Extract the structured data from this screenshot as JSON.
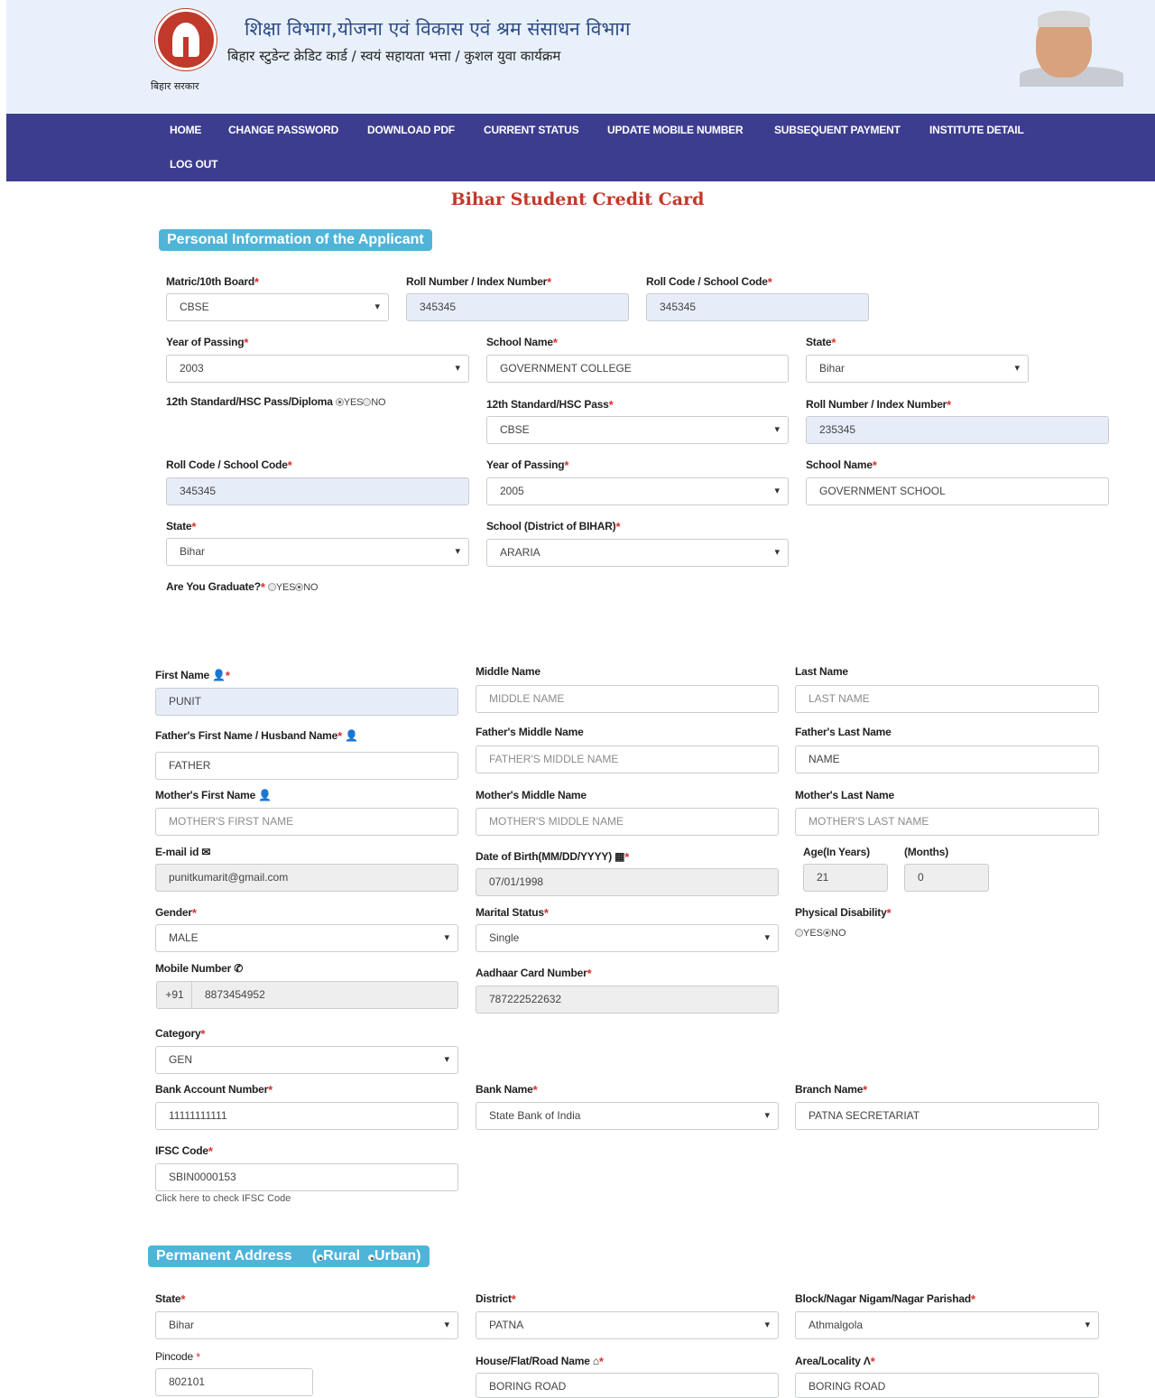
{
  "header": {
    "title": "शिक्षा विभाग,योजना एवं विकास एवं श्रम संसाधन विभाग",
    "subtitle": "बिहार स्टुडेन्ट क्रेडिट कार्ड / स्वयं सहायता भत्ता / कुशल युवा कार्यक्रम",
    "emblem_text": "बिहार सरकार"
  },
  "nav": [
    "HOME",
    "CHANGE PASSWORD",
    "DOWNLOAD PDF",
    "CURRENT STATUS",
    "UPDATE MOBILE NUMBER",
    "SUBSEQUENT PAYMENT",
    "INSTITUTE DETAIL",
    "LOG OUT"
  ],
  "page_title": "Bihar Student Credit Card",
  "personal": {
    "heading": "Personal Information of the Applicant",
    "labels": {
      "matric_board": "Matric/10th Board",
      "roll_number": "Roll Number / Index Number",
      "roll_code": "Roll Code / School Code",
      "year_of_passing": "Year of Passing",
      "school_name": "School Name",
      "state": "State",
      "hsc_question": "12th Standard/HSC Pass/Diploma",
      "hsc_pass": "12th Standard/HSC Pass",
      "hsc_roll_number": "Roll Number / Index Number",
      "hsc_roll_code": "Roll Code / School Code",
      "hsc_year": "Year of Passing",
      "hsc_school_name": "School Name",
      "hsc_state": "State",
      "school_district": "School (District of BIHAR)",
      "graduate_question": "Are You Graduate?"
    },
    "values": {
      "matric_board": "CBSE",
      "roll_number": "345345",
      "roll_code": "345345",
      "year_of_passing": "2003",
      "school_name": "GOVERNMENT COLLEGE",
      "state": "Bihar",
      "hsc_pass": "CBSE",
      "hsc_roll_number": "235345",
      "hsc_roll_code": "345345",
      "hsc_year": "2005",
      "hsc_school_name": "GOVERNMENT SCHOOL",
      "hsc_state": "Bihar",
      "school_district": "ARARIA"
    },
    "radio": {
      "yes": "YES",
      "no": "NO"
    }
  },
  "applicant": {
    "labels": {
      "first_name": "First Name",
      "middle_name": "Middle Name",
      "last_name": "Last Name",
      "father_first": "Father's First Name / Husband Name",
      "father_middle": "Father's Middle Name",
      "father_last": "Father's Last Name",
      "mother_first": "Mother's First Name",
      "mother_middle": "Mother's Middle Name",
      "mother_last": "Mother's Last Name",
      "email": "E-mail id",
      "dob": "Date of Birth(MM/DD/YYYY)",
      "age_years": "Age(In Years)",
      "age_months": "(Months)",
      "gender": "Gender",
      "marital_status": "Marital Status",
      "physical_disability": "Physical Disability",
      "mobile": "Mobile Number",
      "aadhaar": "Aadhaar Card Number",
      "category": "Category",
      "bank_account": "Bank Account Number",
      "bank_name": "Bank Name",
      "branch_name": "Branch Name",
      "ifsc": "IFSC Code"
    },
    "values": {
      "first_name": "PUNIT",
      "father_first": "FATHER",
      "father_last": "NAME",
      "email": "punitkumarit@gmail.com",
      "dob": "07/01/1998",
      "age_years": "21",
      "age_months": "0",
      "gender": "MALE",
      "marital_status": "Single",
      "mobile_prefix": "+91",
      "mobile": "8873454952",
      "aadhaar": "787222522632",
      "category": "GEN",
      "bank_account": "11111111111",
      "bank_name": "State Bank of India",
      "branch_name": "PATNA SECRETARIAT",
      "ifsc": "SBIN0000153"
    },
    "placeholders": {
      "middle_name": "MIDDLE NAME",
      "last_name": "LAST NAME",
      "father_middle": "FATHER'S MIDDLE NAME",
      "mother_first": "MOTHER'S FIRST NAME",
      "mother_middle": "MOTHER'S MIDDLE NAME",
      "mother_last": "MOTHER'S LAST NAME"
    },
    "ifsc_helper": "Click here to check IFSC Code"
  },
  "address": {
    "heading": "Permanent Address",
    "rural": "Rural",
    "urban": "Urban",
    "labels": {
      "state": "State",
      "district": "District",
      "block": "Block/Nagar Nigam/Nagar Parishad",
      "pincode": "Pincode",
      "house": "House/Flat/Road Name",
      "area": "Area/Locality"
    },
    "values": {
      "state": "Bihar",
      "district": "PATNA",
      "block": "Athmalgola",
      "pincode": "802101",
      "house": "BORING ROAD",
      "area": "BORING ROAD"
    }
  },
  "icons": [
    "user-icon",
    "envelope-icon",
    "calendar-icon",
    "phone-icon",
    "home-icon",
    "road-icon"
  ],
  "colors": {
    "nav_bg": "#3d3d8f",
    "badge_bg": "#4fb4d8",
    "title_red": "#c0392b",
    "required_red": "#d9302c"
  }
}
